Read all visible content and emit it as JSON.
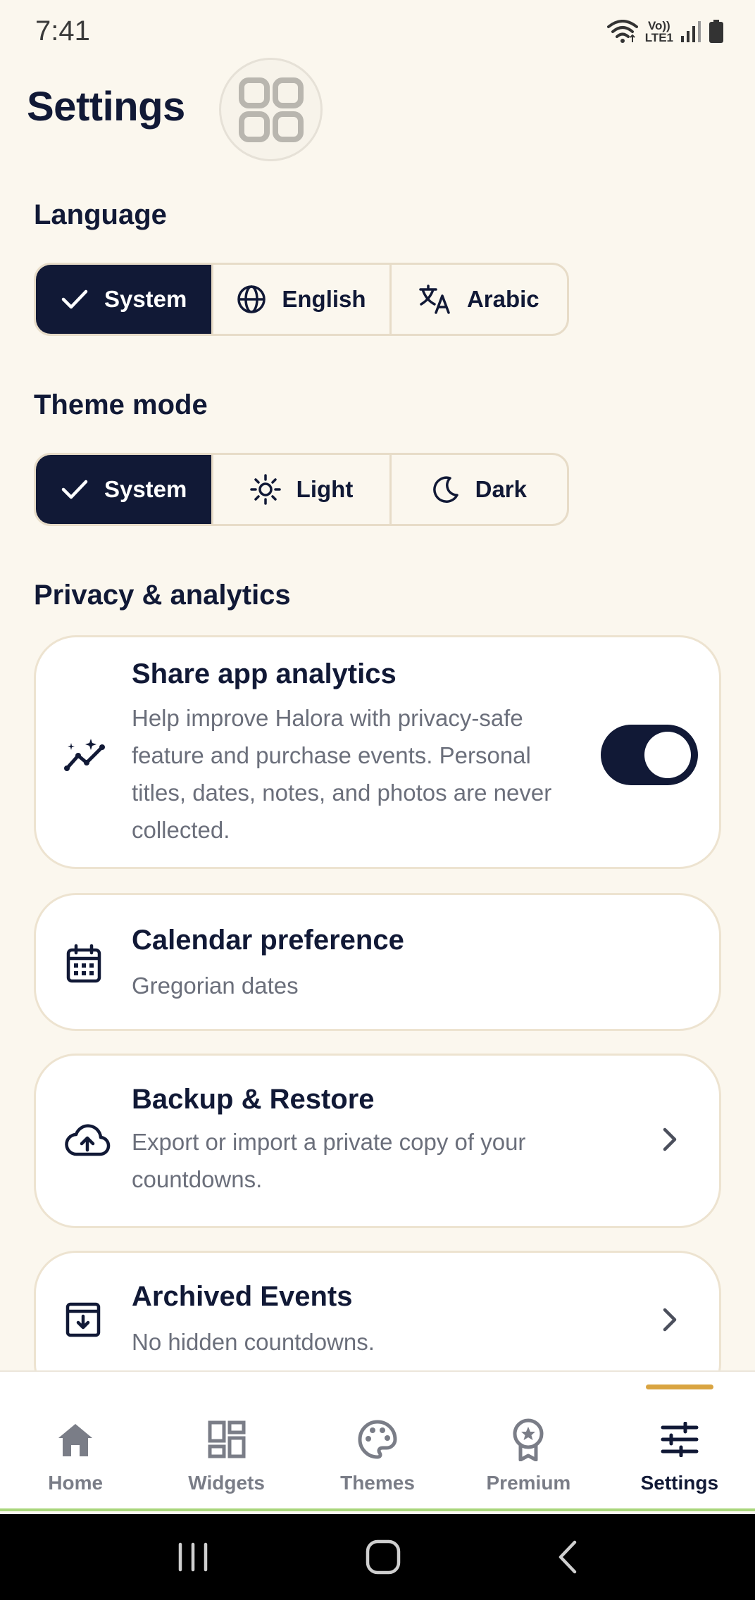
{
  "status_bar": {
    "time": "7:41",
    "volte_top": "Vo))",
    "volte_bottom": "LTE1"
  },
  "header": {
    "title": "Settings"
  },
  "language": {
    "heading": "Language",
    "options": [
      {
        "label": "System",
        "selected": true
      },
      {
        "label": "English",
        "selected": false
      },
      {
        "label": "Arabic",
        "selected": false
      }
    ]
  },
  "theme_mode": {
    "heading": "Theme mode",
    "options": [
      {
        "label": "System",
        "selected": true
      },
      {
        "label": "Light",
        "selected": false
      },
      {
        "label": "Dark",
        "selected": false
      }
    ]
  },
  "privacy": {
    "heading": "Privacy & analytics",
    "analytics": {
      "title": "Share app analytics",
      "desc_lines": [
        "Help improve Halora with privacy-safe",
        "feature and purchase events. Personal",
        "titles, dates, notes, and photos are never",
        "collected."
      ],
      "enabled": true
    },
    "calendar": {
      "title": "Calendar preference",
      "desc": "Gregorian dates"
    },
    "backup": {
      "title": "Backup & Restore",
      "desc_lines": [
        "Export or import a private copy of your",
        "countdowns."
      ]
    },
    "archived": {
      "title": "Archived Events",
      "desc": "No hidden countdowns."
    }
  },
  "bottom_nav": [
    {
      "label": "Home",
      "icon": "home-icon"
    },
    {
      "label": "Widgets",
      "icon": "widgets-icon"
    },
    {
      "label": "Themes",
      "icon": "palette-icon"
    },
    {
      "label": "Premium",
      "icon": "award-icon"
    },
    {
      "label": "Settings",
      "icon": "sliders-icon",
      "active": true
    }
  ],
  "colors": {
    "primary": "#111936",
    "background": "#FBF7EE",
    "accent": "#D9A441",
    "muted": "#6B6F7B"
  }
}
